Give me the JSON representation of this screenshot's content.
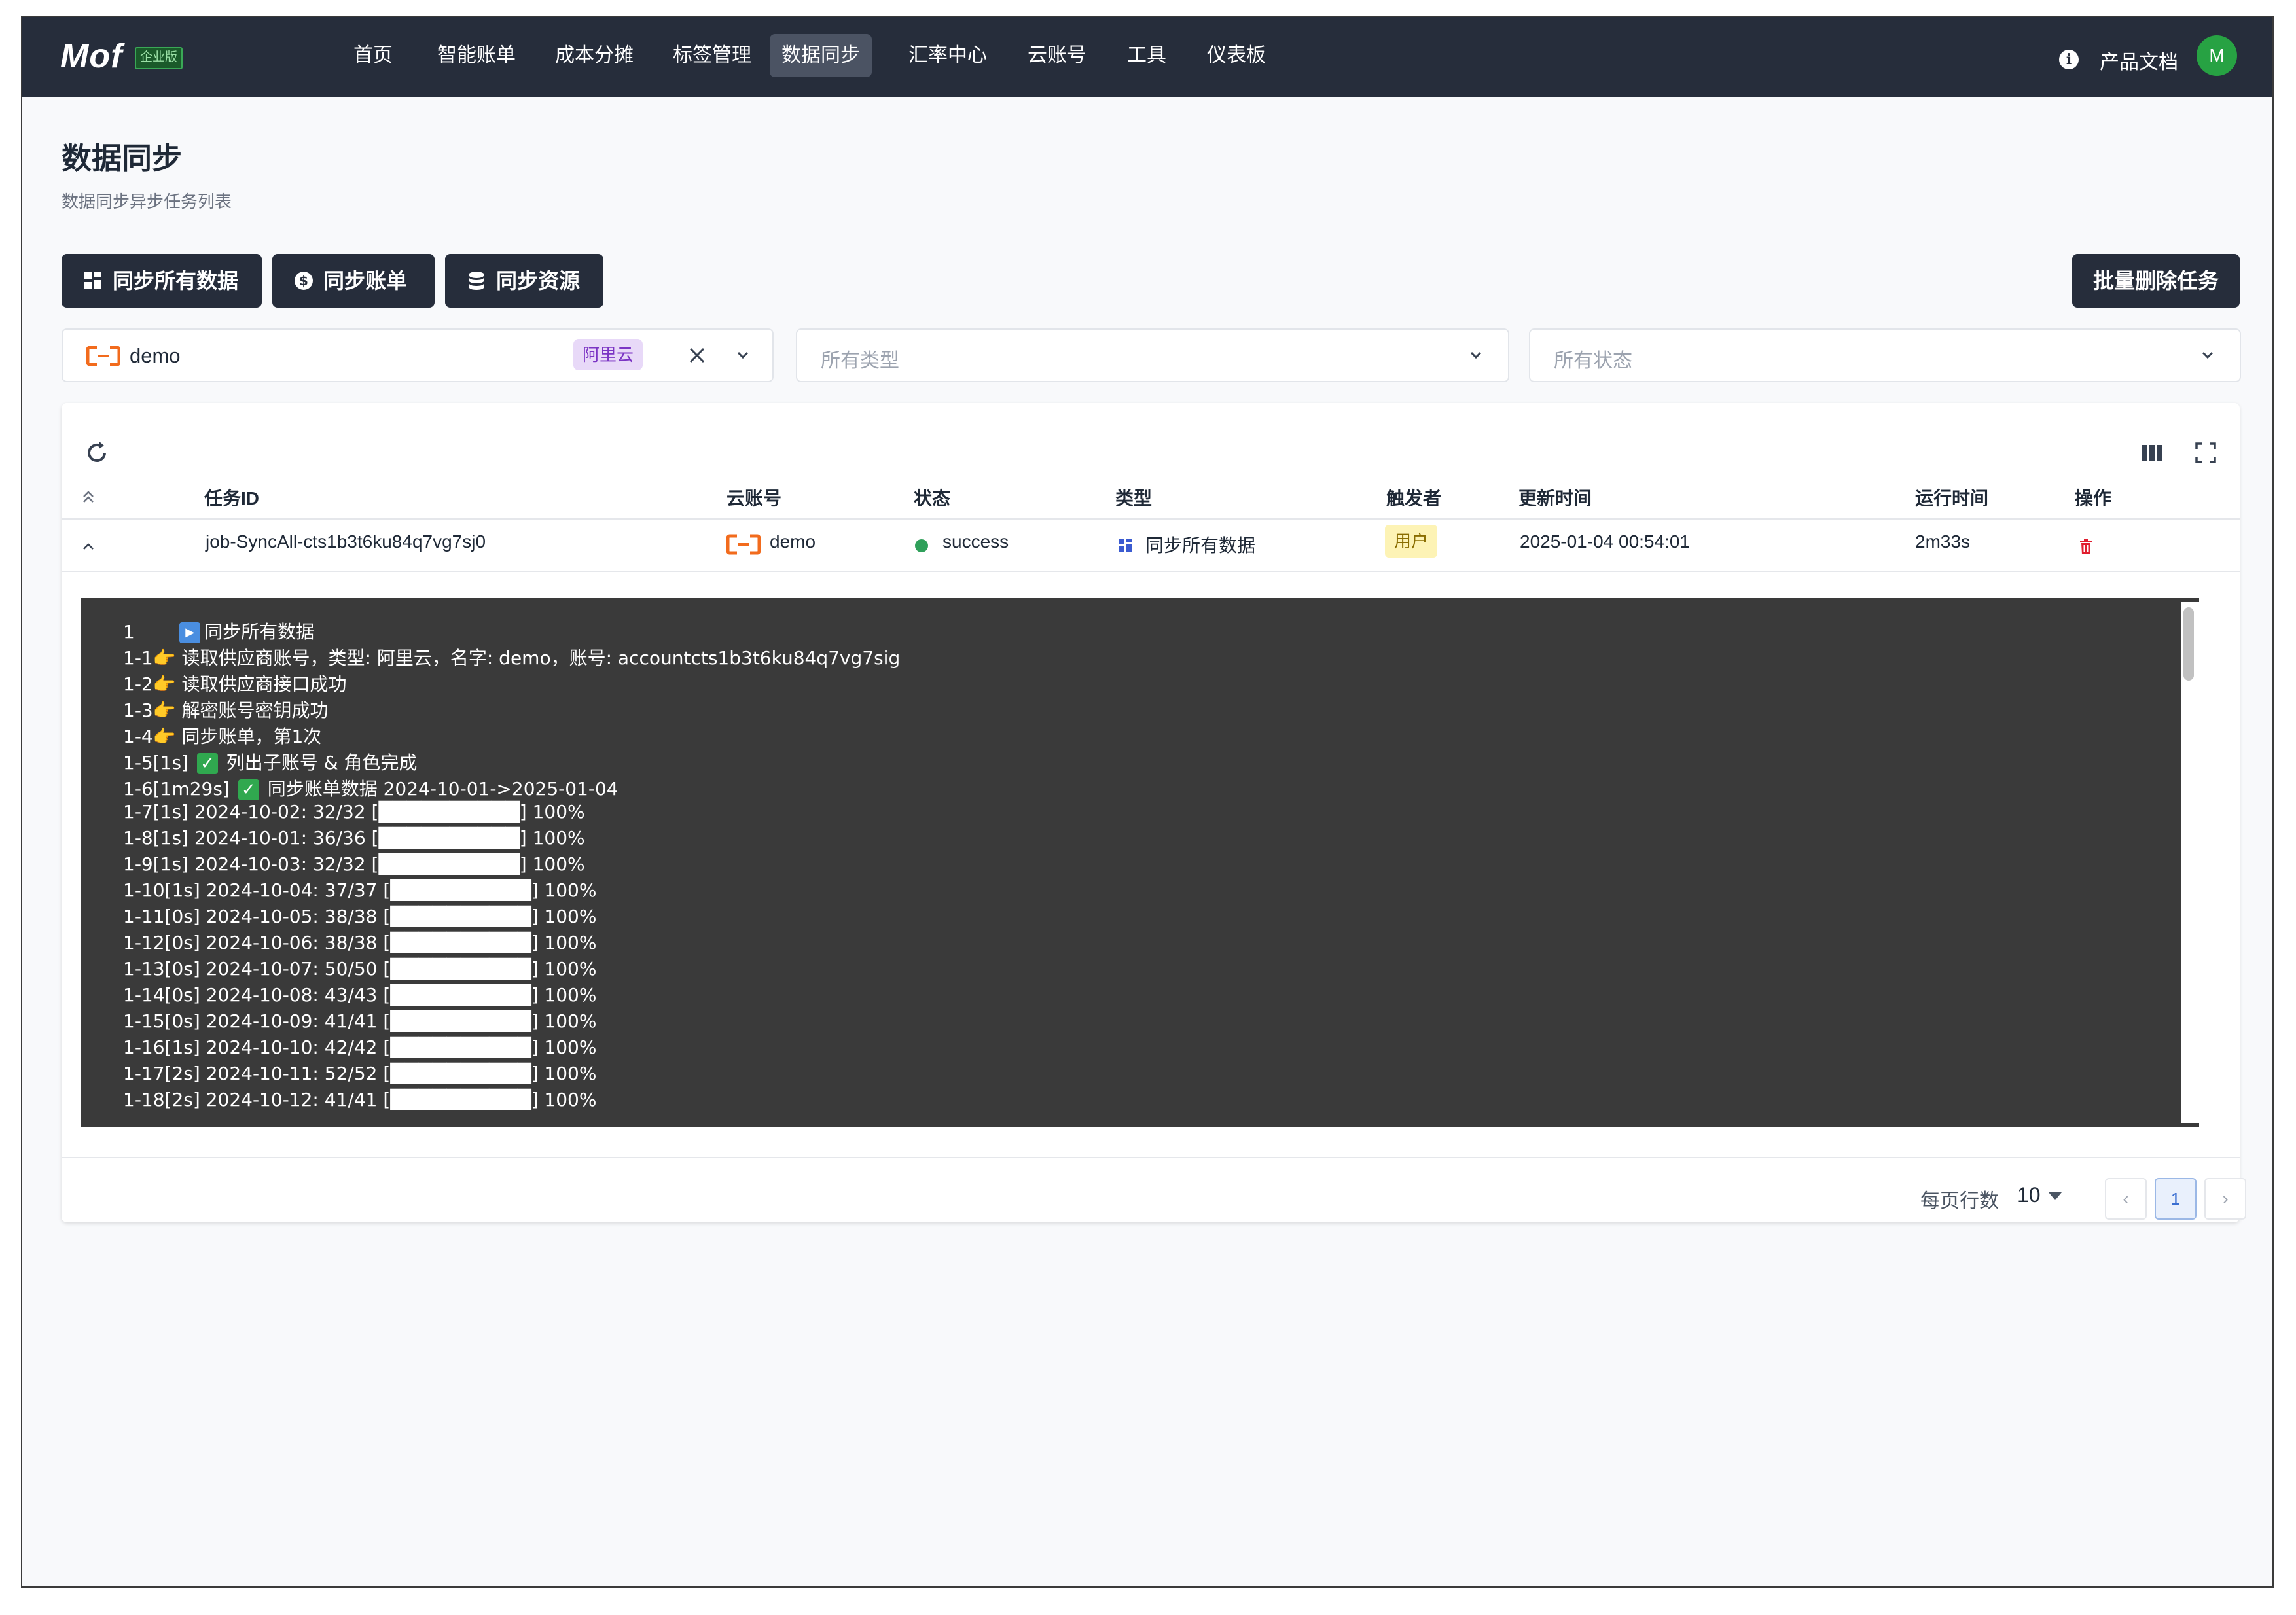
{
  "nav": {
    "logo": "Mof",
    "logo_badge": "企业版",
    "items": [
      "首页",
      "智能账单",
      "成本分摊",
      "标签管理",
      "数据同步",
      "汇率中心",
      "云账号",
      "工具",
      "仪表板"
    ],
    "active_index": 4,
    "docs": "产品文档",
    "avatar": "M"
  },
  "page": {
    "title": "数据同步",
    "subtitle": "数据同步异步任务列表"
  },
  "actions": {
    "sync_all": "同步所有数据",
    "sync_bill": "同步账单",
    "sync_resource": "同步资源",
    "batch_delete": "批量删除任务"
  },
  "filters": {
    "account_value": "demo",
    "account_provider": "阿里云",
    "type_placeholder": "所有类型",
    "status_placeholder": "所有状态"
  },
  "table": {
    "headers": [
      "任务ID",
      "云账号",
      "状态",
      "类型",
      "触发者",
      "更新时间",
      "运行时间",
      "操作"
    ],
    "row": {
      "id": "job-SyncAll-cts1b3t6ku84q7vg7sj0",
      "account": "demo",
      "status": "success",
      "type": "同步所有数据",
      "trigger": "用户",
      "updated": "2025-01-04 00:54:01",
      "runtime": "2m33s"
    }
  },
  "log": {
    "lines": [
      "1       ▶ 同步所有数据",
      "1-1👉 读取供应商账号，类型: 阿里云，名字: demo，账号: accountcts1b3t6ku84q7vg7sig",
      "1-2👉 读取供应商接口成功",
      "1-3👉 解密账号密钥成功",
      "1-4👉 同步账单，第1次",
      "1-5[1s] ✅ 列出子账号 & 角色完成",
      "1-6[1m29s] ✅ 同步账单数据 2024-10-01->2025-01-04",
      "1-7[1s] 2024-10-02: 32/32 [██████████] 100%",
      "1-8[1s] 2024-10-01: 36/36 [██████████] 100%",
      "1-9[1s] 2024-10-03: 32/32 [██████████] 100%",
      "1-10[1s] 2024-10-04: 37/37 [██████████] 100%",
      "1-11[0s] 2024-10-05: 38/38 [██████████] 100%",
      "1-12[0s] 2024-10-06: 38/38 [██████████] 100%",
      "1-13[0s] 2024-10-07: 50/50 [██████████] 100%",
      "1-14[0s] 2024-10-08: 43/43 [██████████] 100%",
      "1-15[0s] 2024-10-09: 41/41 [██████████] 100%",
      "1-16[1s] 2024-10-10: 42/42 [██████████] 100%",
      "1-17[2s] 2024-10-11: 52/52 [██████████] 100%",
      "1-18[2s] 2024-10-12: 41/41 [██████████] 100%"
    ]
  },
  "pagination": {
    "per_page_label": "每页行数",
    "per_page_value": "10",
    "current_page": "1"
  }
}
